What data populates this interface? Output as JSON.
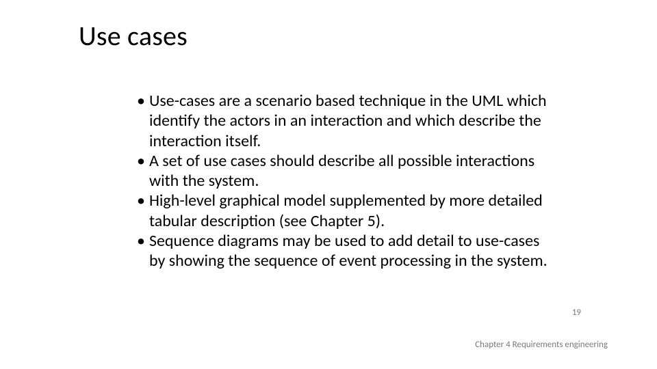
{
  "slide": {
    "title": "Use cases",
    "bullets": [
      "Use-cases are a scenario based technique in the UML which identify the actors in an interaction and which describe the interaction itself.",
      "A set of use cases should describe all possible interactions with the system.",
      "High-level graphical model supplemented by more detailed tabular description (see Chapter 5).",
      "Sequence diagrams may be used to add detail to use-cases by showing the sequence of event processing in the system."
    ],
    "page_number": "19",
    "footer": "Chapter 4 Requirements engineering"
  }
}
